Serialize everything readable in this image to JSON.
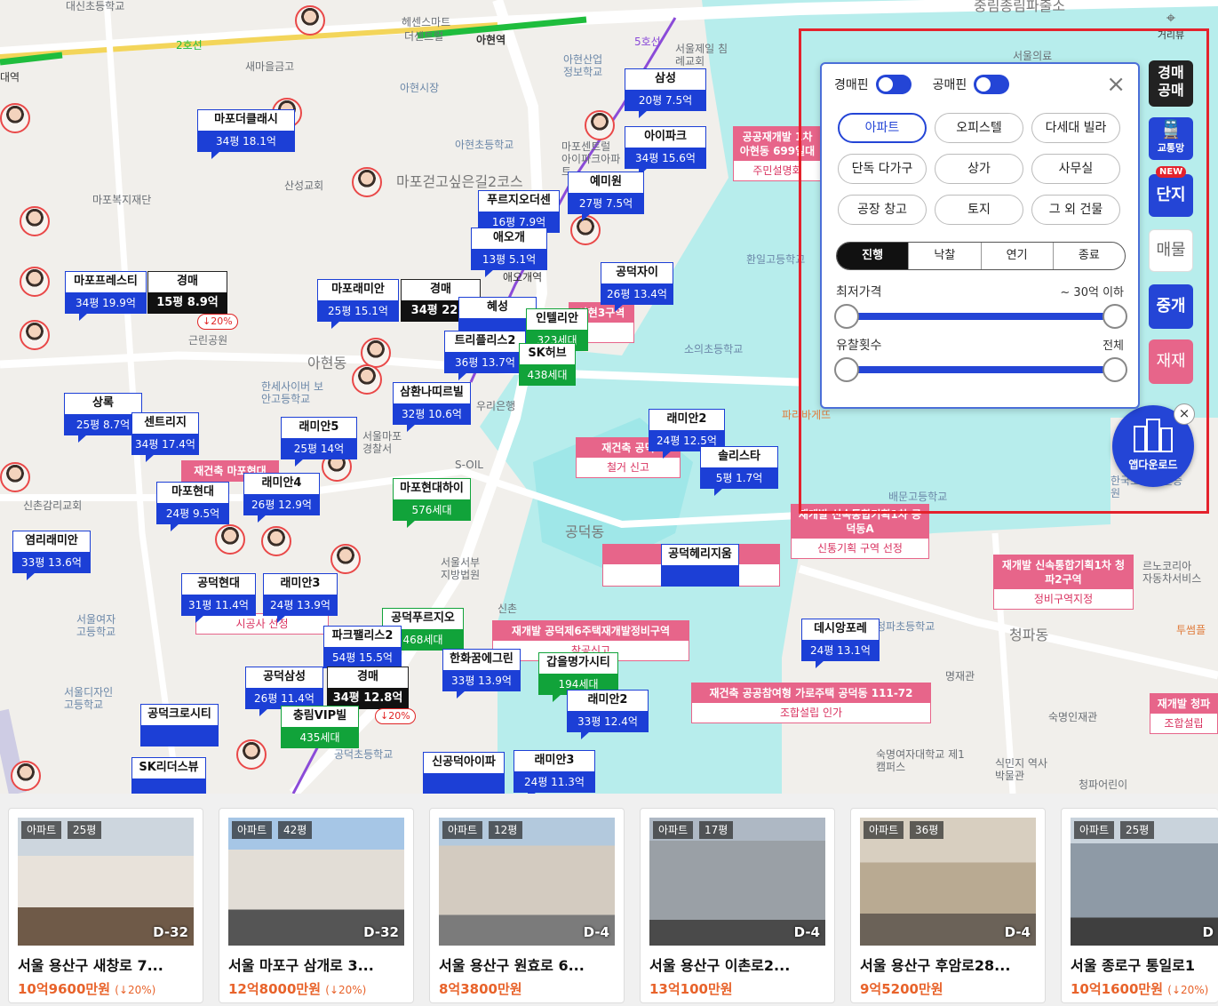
{
  "map": {
    "places": [
      {
        "name": "대신초등학교"
      },
      {
        "name": "헤센스마트"
      },
      {
        "name": "더센트럴"
      },
      {
        "name": "아현역"
      },
      {
        "name": "새마을금고"
      },
      {
        "name": "아현시장"
      },
      {
        "name": "아현산업 정보학교"
      },
      {
        "name": "서울제일 침례교회"
      },
      {
        "name": "중림종림파출소"
      },
      {
        "name": "서울의료"
      },
      {
        "name": "마포복지재단"
      },
      {
        "name": "산성교회"
      },
      {
        "name": "마포걷고싶은길2코스"
      },
      {
        "name": "아현초등학교"
      },
      {
        "name": "마포센트럴 아이파크아파트"
      },
      {
        "name": "애오개역"
      },
      {
        "name": "환일고등학교"
      },
      {
        "name": "근린공원"
      },
      {
        "name": "아현동"
      },
      {
        "name": "한세사이버 보안고등학교"
      },
      {
        "name": "소의초등학교"
      },
      {
        "name": "서울마포 경찰서"
      },
      {
        "name": "우리은행"
      },
      {
        "name": "S-OIL"
      },
      {
        "name": "신촌감리교회"
      },
      {
        "name": "공덕동"
      },
      {
        "name": "서울서부 지방법원"
      },
      {
        "name": "서울여자 고등학교"
      },
      {
        "name": "서울디자인 고등학교"
      },
      {
        "name": "신촌"
      },
      {
        "name": "공덕초등학교"
      },
      {
        "name": "숙명인재관"
      },
      {
        "name": "명재관"
      },
      {
        "name": "숙명여자대학교 제1캠퍼스"
      },
      {
        "name": "식민지 역사박물관"
      },
      {
        "name": "청파동"
      },
      {
        "name": "청파어린이"
      },
      {
        "name": "르노코리아 자동차서비스"
      },
      {
        "name": "배문고등학교"
      },
      {
        "name": "파리바게뜨"
      },
      {
        "name": "한국조 평가인증원"
      },
      {
        "name": "투썸플"
      },
      {
        "name": "대역"
      },
      {
        "name": "2호선"
      },
      {
        "name": "5호선"
      },
      {
        "name": "청파초등학교"
      }
    ],
    "markers": [
      {
        "title": "마포더클래시",
        "value": "34평 18.1억"
      },
      {
        "title": "삼성",
        "value": "20평 7.5억"
      },
      {
        "title": "아이파크",
        "value": "34평 15.6억"
      },
      {
        "title": "예미원",
        "value": "27평 7.5억"
      },
      {
        "title": "푸르지오더센",
        "value": "16평 7.9억"
      },
      {
        "title": "애오개",
        "value": "13평 5.1억"
      },
      {
        "title": "공덕자이",
        "value": "26평 13.4억"
      },
      {
        "title": "마포프레스티",
        "value": "34평 19.9억"
      },
      {
        "title": "경매",
        "value": "15평 8.9억",
        "pct": "↓20%"
      },
      {
        "title": "마포래미안",
        "value": "25평 15.1억"
      },
      {
        "title": "경매",
        "value": "34평 22.1"
      },
      {
        "title": "혜성",
        "value": ""
      },
      {
        "title": "트리플리스2",
        "value": "36평 13.7억"
      },
      {
        "title": "인텔리안",
        "value": "323세대"
      },
      {
        "title": "SK허브",
        "value": "438세대"
      },
      {
        "title": "삼환나띠르빌",
        "value": "32평 10.6억"
      },
      {
        "title": "상록",
        "value": "25평 8.7억"
      },
      {
        "title": "센트리지",
        "value": "34평 17.4억"
      },
      {
        "title": "래미안5",
        "value": "25평 14억"
      },
      {
        "title": "래미안2",
        "value": "24평 12.5억"
      },
      {
        "title": "솔리스타",
        "value": "5평 1.7억"
      },
      {
        "title": "마포현대",
        "value": "24평 9.5억"
      },
      {
        "title": "래미안4",
        "value": "26평 12.9억"
      },
      {
        "title": "마포현대하이",
        "value": "576세대"
      },
      {
        "title": "염리래미안",
        "value": "33평 13.6억"
      },
      {
        "title": "공덕현대",
        "value": "31평 11.4억"
      },
      {
        "title": "래미안3",
        "value": "24평 13.9억"
      },
      {
        "title": "공덕헤리지움",
        "value": ""
      },
      {
        "title": "공덕푸르지오",
        "value": "468세대"
      },
      {
        "title": "파크팰리스2",
        "value": "54평 15.5억"
      },
      {
        "title": "한화꿈에그린",
        "value": "33평 13.9억"
      },
      {
        "title": "갑을명가시티",
        "value": "194세대"
      },
      {
        "title": "데시앙포레",
        "value": "24평 13.1억"
      },
      {
        "title": "공덕삼성",
        "value": "26평 11.4억"
      },
      {
        "title": "경매",
        "value": "34평 12.8억",
        "pct": "↓20%"
      },
      {
        "title": "래미안2",
        "value": "33평 12.4억"
      },
      {
        "title": "공덕크로시티",
        "value": ""
      },
      {
        "title": "충림VIP빌",
        "value": "435세대"
      },
      {
        "title": "SK리더스뷰",
        "value": ""
      },
      {
        "title": "신공덕아이파",
        "value": ""
      },
      {
        "title": "래미안3",
        "value": "24평 11.3억"
      }
    ],
    "redev": [
      {
        "head": "공공재개발 1차 아현동 699일대",
        "sub": "주민설명회"
      },
      {
        "head": "재개발 신속통합기획1차 공덕동A",
        "sub": "신통기획 구역 선정"
      },
      {
        "head": "재건축 공덕",
        "sub": "철거 신고"
      },
      {
        "head": "재개발 신속통합기획1차 청파2구역",
        "sub": "정비구역지정"
      },
      {
        "head": "재개발 공덕제6주택재개발정비구역",
        "sub": "착공신고"
      },
      {
        "head": "재건축 공공참여형 가로주택 공덕동 111-72",
        "sub": "조합설립 인가"
      },
      {
        "head": "재개발 청파",
        "sub": "조합설립"
      },
      {
        "head": "재건축 마포현대",
        "sub": "시공사 선정"
      },
      {
        "head": "재개발 신",
        "sub": ""
      },
      {
        "head": "아현3구역",
        "sub": ""
      }
    ]
  },
  "panel": {
    "toggle1": "경매핀",
    "toggle2": "공매핀",
    "close": "×",
    "types": [
      "아파트",
      "오피스텔",
      "다세대 빌라",
      "단독 다가구",
      "상가",
      "사무실",
      "공장 창고",
      "토지",
      "그 외 건물"
    ],
    "status": [
      "진행",
      "낙찰",
      "연기",
      "종료"
    ],
    "price_label": "최저가격",
    "price_value": "~ 30억 이하",
    "fail_label": "유찰횟수",
    "fail_value": "전체"
  },
  "toolbar": {
    "distance": "거리뷰",
    "auction_1": "경매",
    "auction_2": "공매",
    "transit": "교통망",
    "new": "NEW",
    "complex": "단지",
    "listing": "매물",
    "broker": "중개",
    "redo": "재재",
    "app_download": "앱다운로드",
    "app_close": "×"
  },
  "cards": [
    {
      "type": "아파트",
      "size": "25평",
      "dday": "D-32",
      "addr": "서울 용산구 새창로 7...",
      "price": "10억9600만원",
      "pct": "(↓20%)"
    },
    {
      "type": "아파트",
      "size": "42평",
      "dday": "D-32",
      "addr": "서울 마포구 삼개로 3...",
      "price": "12억8000만원",
      "pct": "(↓20%)"
    },
    {
      "type": "아파트",
      "size": "12평",
      "dday": "D-4",
      "addr": "서울 용산구 원효로 6...",
      "price": "8억3800만원",
      "pct": ""
    },
    {
      "type": "아파트",
      "size": "17평",
      "dday": "D-4",
      "addr": "서울 용산구 이촌로2...",
      "price": "13억100만원",
      "pct": ""
    },
    {
      "type": "아파트",
      "size": "36평",
      "dday": "D-4",
      "addr": "서울 용산구 후암로28...",
      "price": "9억5200만원",
      "pct": ""
    },
    {
      "type": "아파트",
      "size": "25평",
      "dday": "D",
      "addr": "서울 종로구 통일로1",
      "price": "10억1600만원",
      "pct": "(↓20%)"
    }
  ],
  "colors": {
    "accent": "#2445d6",
    "green": "#11a33a",
    "redev": "#e7658a",
    "highlight": "#e4222c",
    "price": "#e8632b"
  }
}
